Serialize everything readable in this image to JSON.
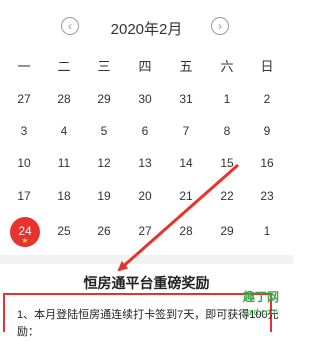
{
  "calendar": {
    "title": "2020年2月",
    "prev_icon": "chevron-left-icon",
    "next_icon": "chevron-right-icon",
    "weekdays": [
      "一",
      "二",
      "三",
      "四",
      "五",
      "六",
      "日"
    ],
    "weeks": [
      [
        "27",
        "28",
        "29",
        "30",
        "31",
        "1",
        "2"
      ],
      [
        "3",
        "4",
        "5",
        "6",
        "7",
        "8",
        "9"
      ],
      [
        "10",
        "11",
        "12",
        "13",
        "14",
        "15",
        "16"
      ],
      [
        "17",
        "18",
        "19",
        "20",
        "21",
        "22",
        "23"
      ],
      [
        "24",
        "25",
        "26",
        "27",
        "28",
        "29",
        "1"
      ]
    ],
    "today": "24",
    "today_marker": "★",
    "dim_color": "#999999",
    "today_color": "#e8322e"
  },
  "reward": {
    "title": "恒房通平台重磅奖励",
    "line1": "1、本月登陆恒房通连续打卡签到7天，即可获得100元",
    "line2": "励："
  },
  "watermark": {
    "text": "趣丁网",
    "url": "qzd.com"
  },
  "colors": {
    "accent": "#e8322e",
    "watermark": "#3ea64a"
  }
}
